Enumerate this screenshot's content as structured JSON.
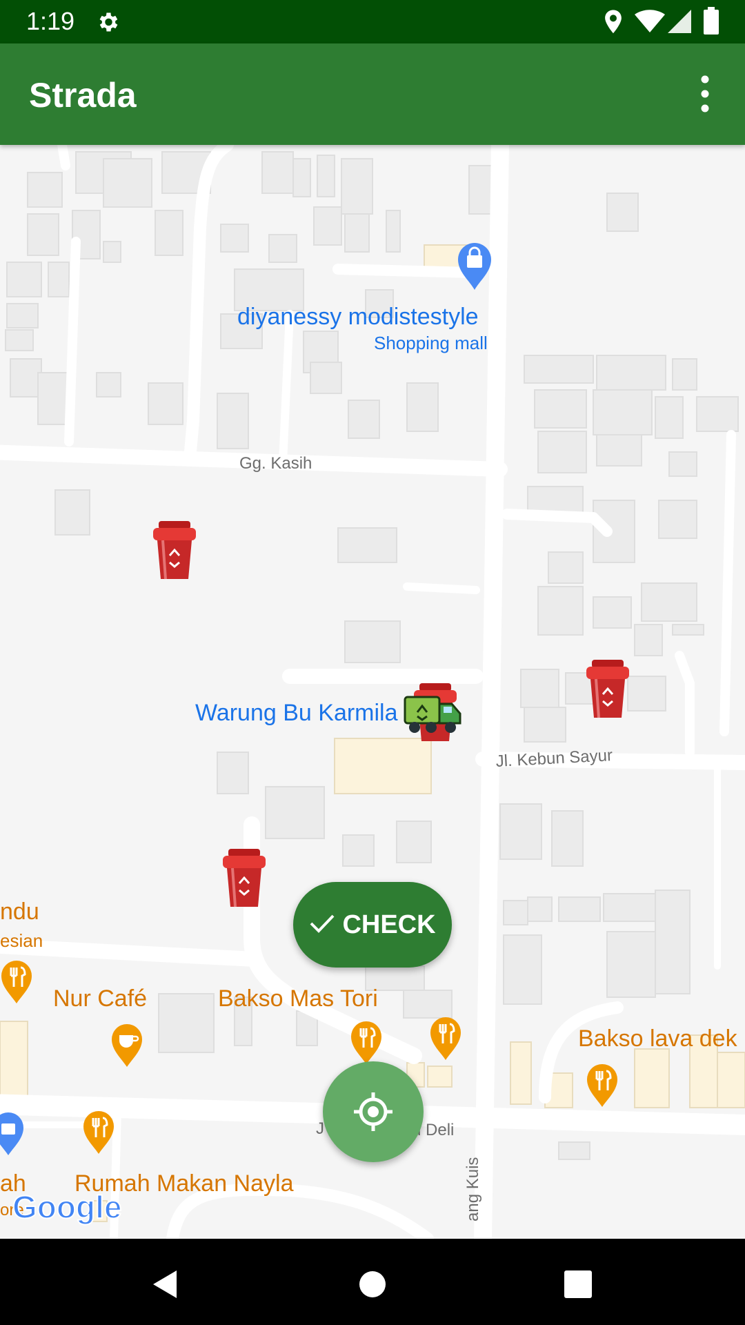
{
  "status_bar": {
    "time": "1:19",
    "icons": [
      "gear-icon",
      "location-icon",
      "wifi-icon",
      "signal-icon",
      "battery-icon"
    ]
  },
  "app_bar": {
    "title": "Strada",
    "menu_icon": "more-vert-icon"
  },
  "map": {
    "places": {
      "shop_name": "diyanessy modistestyle",
      "shop_category": "Shopping mall",
      "warung": "Warung Bu Karmila",
      "nur_cafe": "Nur Café",
      "bakso_mas_tori": "Bakso Mas Tori",
      "bakso_lava": "Bakso lava dek",
      "rumah_makan": "Rumah Makan Nayla",
      "left_partial_1": "ndu",
      "left_partial_2": "esian",
      "left_partial_3": "ah",
      "left_partial_4": "ore"
    },
    "streets": {
      "gg_kasih": "Gg. Kasih",
      "jl_kebun_sayur": "Jl. Kebun Sayur",
      "bottom_left_partial": "J",
      "bottom_right_partial": "u Deli",
      "vertical": "ang Kuis"
    },
    "markers": {
      "bins": [
        "trash-bin-icon",
        "trash-bin-icon",
        "trash-bin-icon",
        "trash-bin-icon"
      ],
      "truck": "garbage-truck-icon"
    },
    "attribution": "Google"
  },
  "check_button": {
    "label": "CHECK",
    "icon": "check-icon"
  },
  "location_button": {
    "icon": "my-location-icon"
  },
  "colors": {
    "status_bar": "#024f05",
    "app_bar": "#2e7d32",
    "check_button": "#2e7d32",
    "location_button": "#63ab66",
    "bin_red": "#c62828",
    "poi_blue": "#1a73e8",
    "poi_orange": "#d67600"
  },
  "nav_bar": {
    "icons": [
      "back-icon",
      "home-icon",
      "recents-icon"
    ]
  }
}
